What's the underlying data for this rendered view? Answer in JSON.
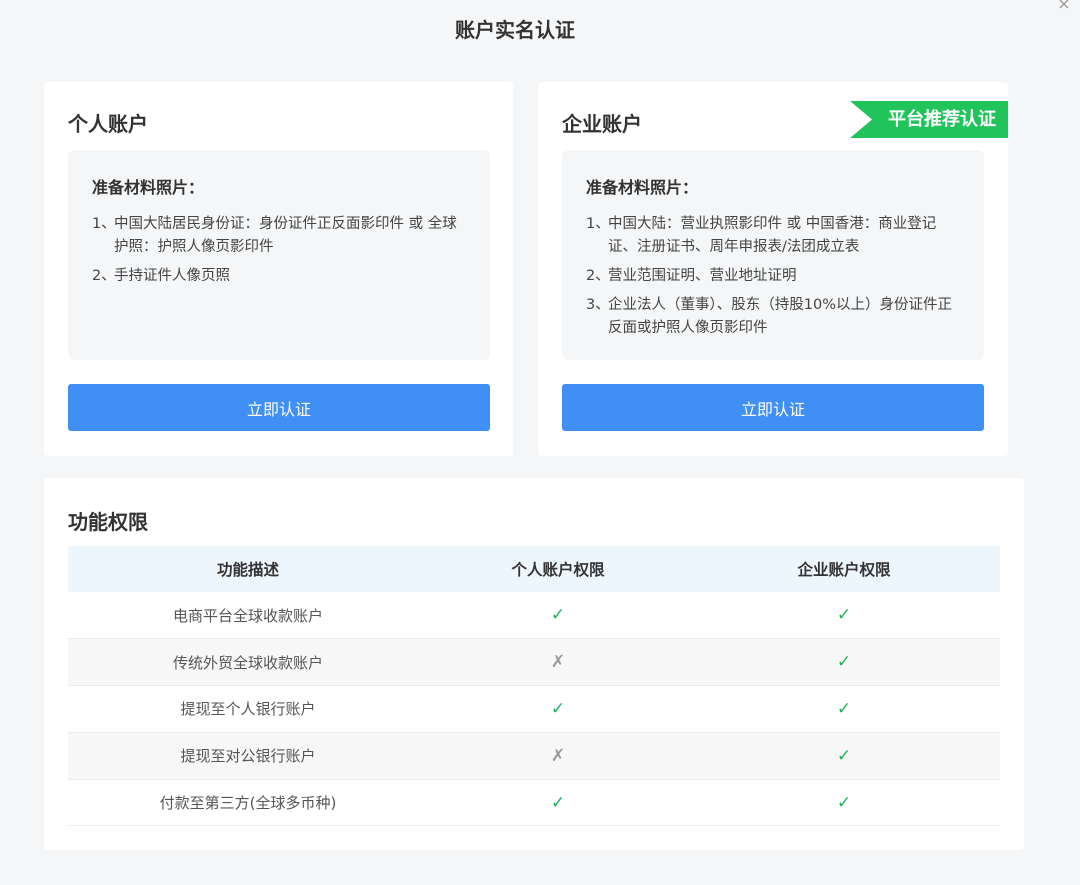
{
  "dialog": {
    "title": "账户实名认证",
    "close_glyph": "×"
  },
  "personal": {
    "title": "个人账户",
    "materials_title": "准备材料照片：",
    "items": [
      {
        "num": "1、",
        "text": "中国大陆居民身份证：身份证件正反面影印件 或 全球护照：护照人像页影印件"
      },
      {
        "num": "2、",
        "text": "手持证件人像页照"
      }
    ],
    "button": "立即认证"
  },
  "company": {
    "title": "企业账户",
    "badge": "平台推荐认证",
    "materials_title": "准备材料照片：",
    "items": [
      {
        "num": "1、",
        "text": "中国大陆：营业执照影印件 或 中国香港：商业登记证、注册证书、周年申报表/法团成立表"
      },
      {
        "num": "2、",
        "text": "营业范围证明、营业地址证明"
      },
      {
        "num": "3、",
        "text": "企业法人（董事）、股东（持股10%以上）身份证件正反面或护照人像页影印件"
      }
    ],
    "button": "立即认证"
  },
  "permissions": {
    "title": "功能权限",
    "headers": [
      "功能描述",
      "个人账户权限",
      "企业账户权限"
    ],
    "yes_glyph": "✓",
    "no_glyph": "✗",
    "rows": [
      {
        "feature": "电商平台全球收款账户",
        "personal": true,
        "company": true
      },
      {
        "feature": "传统外贸全球收款账户",
        "personal": false,
        "company": true
      },
      {
        "feature": "提现至个人银行账户",
        "personal": true,
        "company": true
      },
      {
        "feature": "提现至对公银行账户",
        "personal": false,
        "company": true
      },
      {
        "feature": "付款至第三方(全球多币种)",
        "personal": true,
        "company": true
      }
    ]
  },
  "colors": {
    "accent": "#3f8ff5",
    "badge": "#21c35b",
    "check": "#21b35a"
  }
}
